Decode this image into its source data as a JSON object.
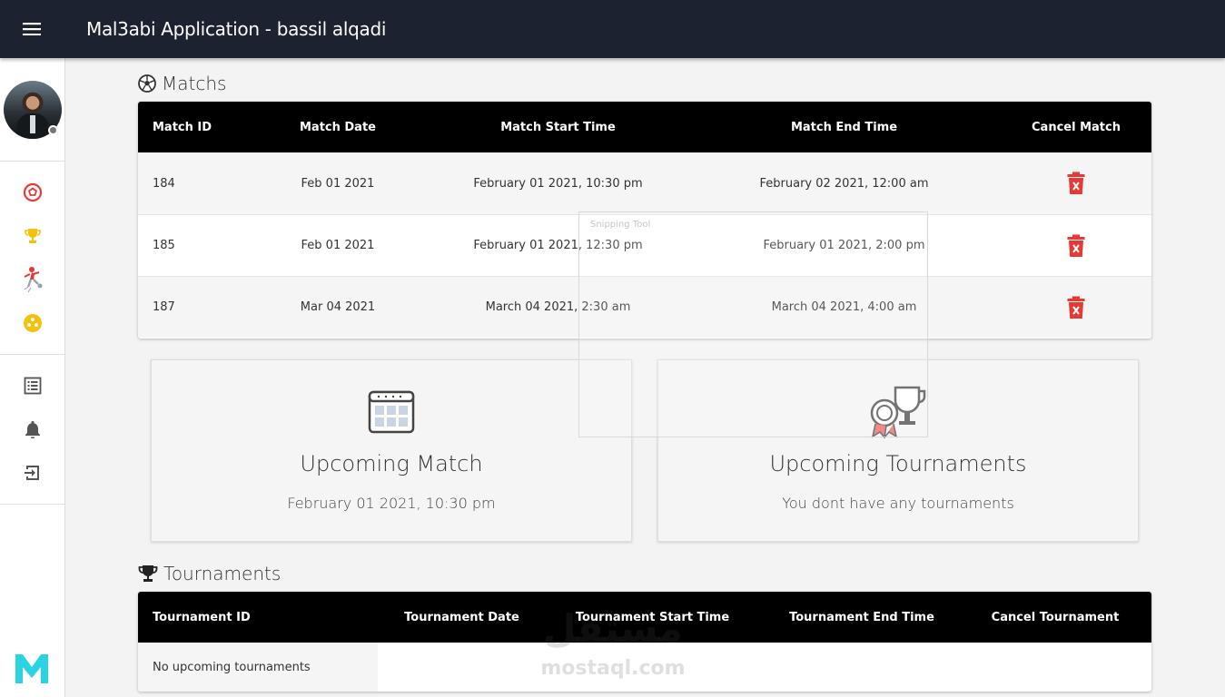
{
  "app": {
    "title": "Mal3abi Application - bassil alqadi"
  },
  "sidebar": {
    "items": [
      {
        "icon": "soccer-ball-icon",
        "color": "#e53935"
      },
      {
        "icon": "trophy-icon",
        "color": "#f4c20d"
      },
      {
        "icon": "player-kicking-icon",
        "color": "#e53935"
      },
      {
        "icon": "ball-icon",
        "color": "#f4c20d"
      },
      {
        "icon": "list-icon",
        "color": "#555555"
      },
      {
        "icon": "bell-icon",
        "color": "#555555"
      },
      {
        "icon": "logout-icon",
        "color": "#555555"
      }
    ],
    "logo": {
      "icon": "m-logo-icon",
      "color": "#29d3e3"
    },
    "user_status_color": "#757575"
  },
  "matches": {
    "title": "Matchs",
    "headers": {
      "id": "Match ID",
      "date": "Match Date",
      "start": "Match Start Time",
      "end": "Match End Time",
      "cancel": "Cancel Match"
    },
    "rows": [
      {
        "id": "184",
        "date": "Feb 01 2021",
        "start": "February 01 2021, 10:30 pm",
        "end": "February 02 2021, 12:00 am"
      },
      {
        "id": "185",
        "date": "Feb 01 2021",
        "start": "February 01 2021, 12:30 pm",
        "end": "February 01 2021, 2:00 pm"
      },
      {
        "id": "187",
        "date": "Mar 04 2021",
        "start": "March 04 2021, 2:30 am",
        "end": "March 04 2021, 4:00 am"
      }
    ],
    "delete_color": "#e53935"
  },
  "cards": {
    "upcoming_match": {
      "title": "Upcoming Match",
      "subtitle": "February 01 2021, 10:30 pm"
    },
    "upcoming_tournaments": {
      "title": "Upcoming Tournaments",
      "subtitle": "You dont have any tournaments"
    }
  },
  "tournaments": {
    "title": "Tournaments",
    "headers": {
      "id": "Tournament ID",
      "date": "Tournament Date",
      "start": "Tournament Start Time",
      "end": "Tournament End Time",
      "cancel": "Cancel Tournament"
    },
    "empty": "No upcoming tournaments"
  },
  "overlay": {
    "snipping_label": "Snipping Tool"
  },
  "watermark": {
    "arabic": "مستقل",
    "latin": "mostaql.com"
  },
  "colors": {
    "topbar": "#1d2230",
    "table_header": "#000000"
  }
}
